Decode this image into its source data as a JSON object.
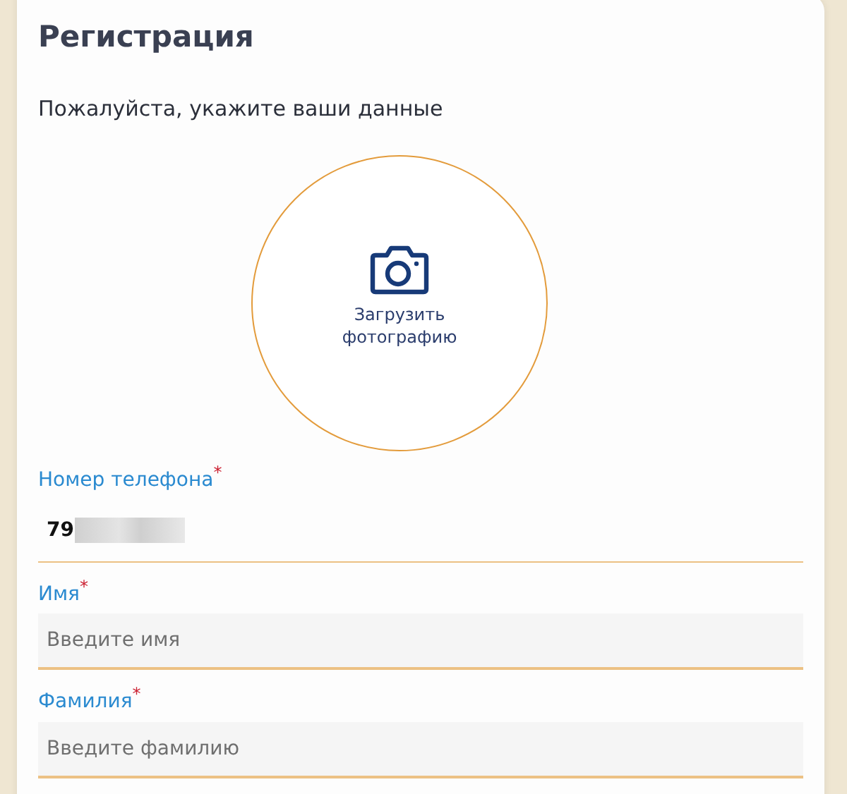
{
  "title": "Регистрация",
  "subtitle": "Пожалуйста, укажите ваши данные",
  "photo_upload": {
    "label": "Загрузить фотографию"
  },
  "fields": [
    {
      "label": "Номер телефона",
      "required_mark": "*",
      "value": "79",
      "redacted": true
    },
    {
      "label": "Имя",
      "required_mark": "*",
      "placeholder": "Введите имя"
    },
    {
      "label": "Фамилия",
      "required_mark": "*",
      "placeholder": "Введите фамилию"
    }
  ]
}
